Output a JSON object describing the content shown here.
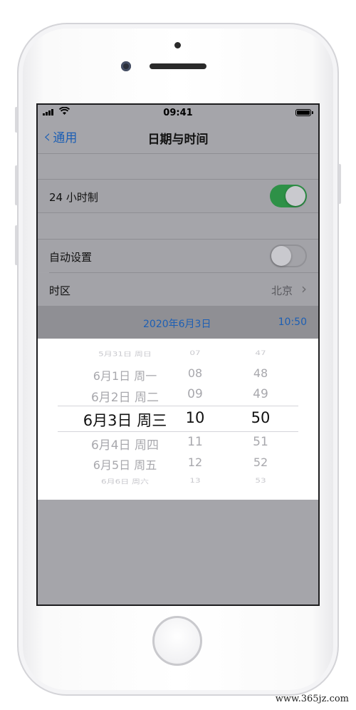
{
  "status_bar": {
    "time": "09:41",
    "wifi_icon": "wifi-icon",
    "signal_icon": "cellular-signal-icon",
    "battery_icon": "battery-icon"
  },
  "nav": {
    "back_label": "通用",
    "title": "日期与时间"
  },
  "settings": {
    "hour24": {
      "label": "24 小时制",
      "enabled": true
    },
    "auto_set": {
      "label": "自动设置",
      "enabled": false
    },
    "timezone": {
      "label": "时区",
      "value": "北京"
    }
  },
  "selected": {
    "date": "2020年6月3日",
    "time": "10:50"
  },
  "picker": {
    "dates": [
      "5月31日 周日",
      "6月1日 周一",
      "6月2日 周二",
      "6月3日 周三",
      "6月4日 周四",
      "6月5日 周五",
      "6月6日 周六"
    ],
    "hours": [
      "07",
      "08",
      "09",
      "10",
      "11",
      "12",
      "13"
    ],
    "minutes": [
      "47",
      "48",
      "49",
      "50",
      "51",
      "52",
      "53"
    ],
    "selected_index": 3
  },
  "colors": {
    "accent": "#1d5fb4",
    "toggle_on": "#2e9147"
  },
  "watermark": "www.365jz.com"
}
